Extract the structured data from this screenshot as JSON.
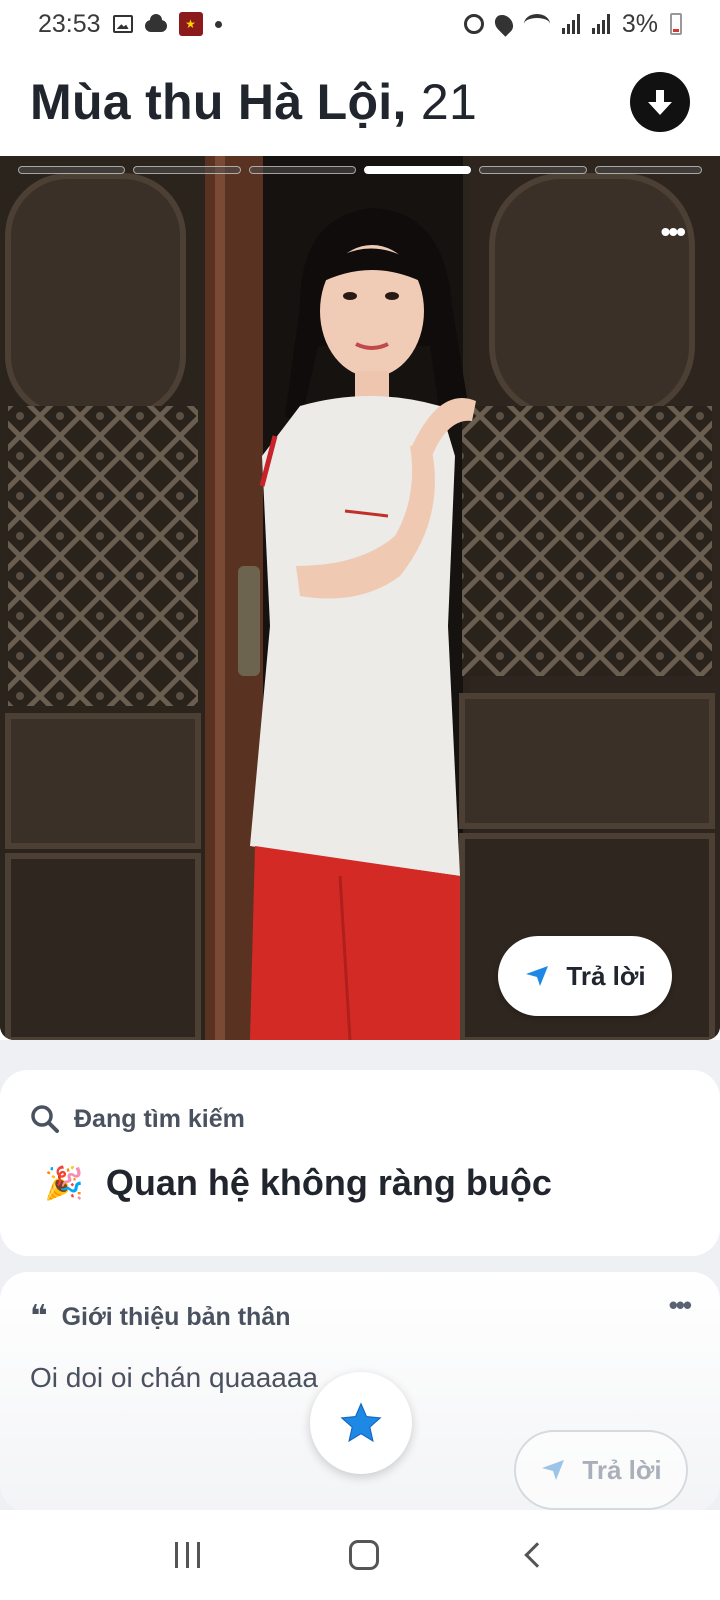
{
  "status_bar": {
    "time": "23:53",
    "battery": "3%"
  },
  "profile": {
    "name": "Mùa thu Hà Lội,",
    "age": "21"
  },
  "photo": {
    "count": 6,
    "active_index": 3,
    "reply_label": "Trả lời"
  },
  "looking_for": {
    "label": "Đang tìm kiếm",
    "value": "Quan hệ không ràng buộc",
    "icon": "party-popper-icon"
  },
  "bio": {
    "label": "Giới thiệu bản thân",
    "text": "Oi doi oi chán quaaaaa",
    "reply_label": "Trả lời"
  },
  "colors": {
    "accent_blue": "#1e88e5",
    "text_dark": "#21262e",
    "text_muted": "#4a5260"
  }
}
